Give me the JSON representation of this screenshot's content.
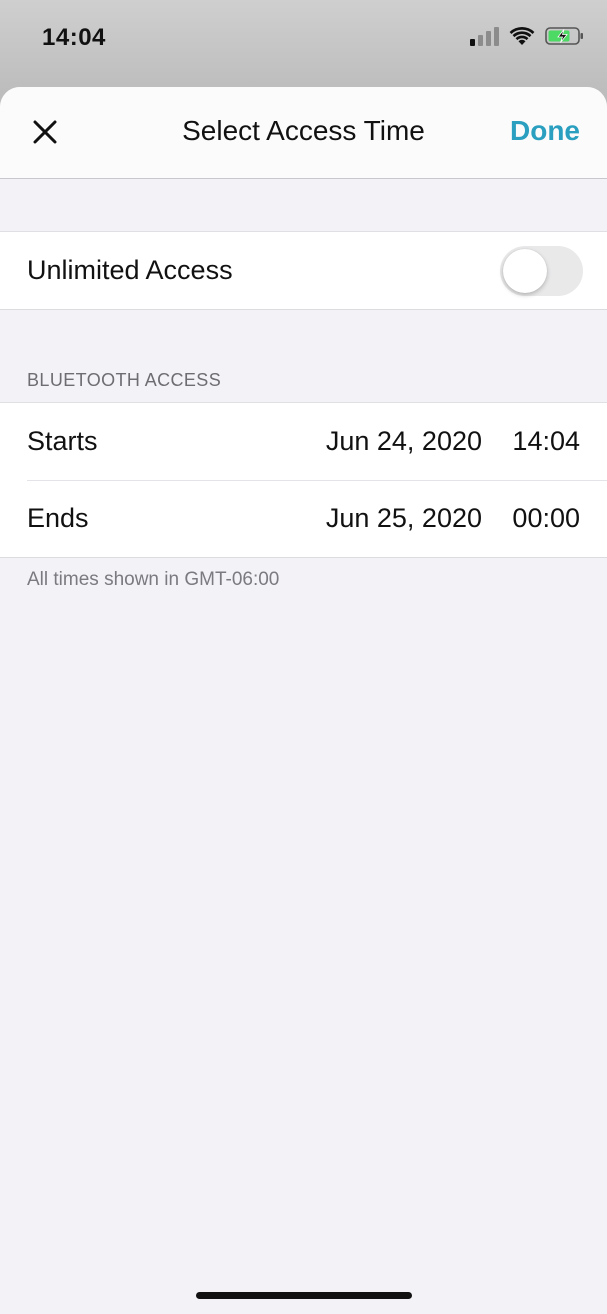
{
  "status_bar": {
    "time": "14:04",
    "icons": [
      "signal-icon",
      "wifi-icon",
      "battery-charging-icon"
    ],
    "battery_color": "#4cd964"
  },
  "nav": {
    "close_icon": "close-icon",
    "title": "Select Access Time",
    "done_label": "Done",
    "accent_color": "#2a9fbf"
  },
  "unlimited_access": {
    "label": "Unlimited Access",
    "enabled": false
  },
  "bluetooth_section": {
    "header": "BLUETOOTH ACCESS",
    "rows": [
      {
        "label": "Starts",
        "date": "Jun 24, 2020",
        "time": "14:04"
      },
      {
        "label": "Ends",
        "date": "Jun 25, 2020",
        "time": "00:00"
      }
    ],
    "footnote": "All times shown in GMT-06:00"
  }
}
